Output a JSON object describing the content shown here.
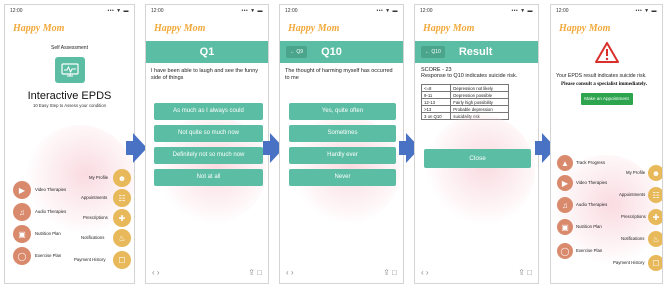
{
  "status": {
    "time": "12:00",
    "signal": "••• ▼ ▬"
  },
  "brand": "Happy Mom",
  "screen1": {
    "self_assessment": "Self Assessment",
    "title": "Interactive EPDS",
    "subtitle": "10 Easy Step to Assess your condition",
    "menu_left": [
      "Video Therapies",
      "Audio Therapies",
      "Nutrition Plan",
      "Exercise Plan"
    ],
    "menu_right": [
      "My Profile",
      "Appointments",
      "Prescriptions",
      "Notifications",
      "Payment History"
    ]
  },
  "screen2": {
    "title": "Q1",
    "question": "I have been able to laugh and see the funny side of things",
    "options": [
      "As much as I always could",
      "Not quite so much now",
      "Definitely not so much now",
      "Not at all"
    ]
  },
  "screen3": {
    "back": "← Q9",
    "title": "Q10",
    "question": "The thought of harming myself has occurred to me",
    "options": [
      "Yes, quite often",
      "Sometimes",
      "Hardly ever",
      "Never"
    ]
  },
  "screen4": {
    "back": "← Q10",
    "title": "Result",
    "score": "SCORE - 23",
    "response": "Response to Q10 indicates suicide risk.",
    "table": [
      [
        "<=8",
        "Depression not likely"
      ],
      [
        "9-11",
        "Depression possible"
      ],
      [
        "12-13",
        "Fairly high possibility"
      ],
      [
        ">13",
        "Probable depression"
      ],
      [
        "3 on Q10",
        "suicidality risk"
      ]
    ],
    "close": "Close"
  },
  "screen5": {
    "message": "Your EPDS result indicates suicide risk.",
    "consult": "Please consult a specialist immediately.",
    "appointment": "Make an Appointment",
    "menu_left": [
      "Track Progress",
      "Video Therapies",
      "Audio Therapies",
      "Nutrition Plan",
      "Exercise Plan"
    ],
    "menu_right": [
      "My Profile",
      "Appointments",
      "Prescriptions",
      "Notifications",
      "Payment History"
    ]
  },
  "colors": {
    "brand": "#f2a93b",
    "accent": "#5bbda3",
    "arrow": "#4a72c4",
    "alert": "#d9302c",
    "appointment": "#2ea44f"
  }
}
